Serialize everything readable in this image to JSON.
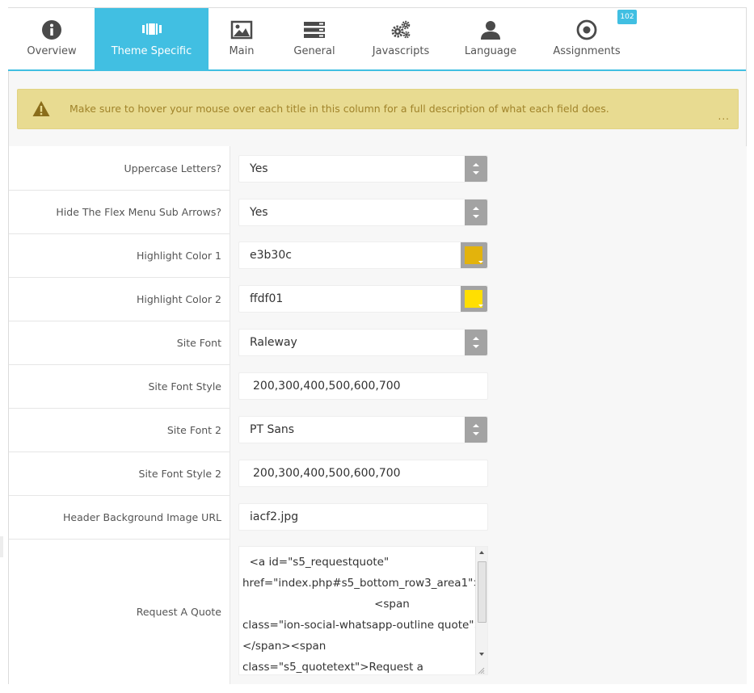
{
  "tabs": [
    {
      "label": "Overview",
      "icon": "info-icon",
      "active": false
    },
    {
      "label": "Theme Specific",
      "icon": "film-icon",
      "active": true
    },
    {
      "label": "Main",
      "icon": "image-icon",
      "active": false
    },
    {
      "label": "General",
      "icon": "server-icon",
      "active": false
    },
    {
      "label": "Javascripts",
      "icon": "gears-icon",
      "active": false
    },
    {
      "label": "Language",
      "icon": "user-icon",
      "active": false
    },
    {
      "label": "Assignments",
      "icon": "target-icon",
      "active": false
    }
  ],
  "badge": "102",
  "alert": {
    "text": "Make sure to hover your mouse over each title in this column for a full description of what each field does.",
    "more": "..."
  },
  "fields": {
    "uppercase": {
      "label": "Uppercase Letters?",
      "value": "Yes"
    },
    "hide_arrows": {
      "label": "Hide The Flex Menu Sub Arrows?",
      "value": "Yes"
    },
    "highlight1": {
      "label": "Highlight Color 1",
      "value": "e3b30c",
      "swatch": "#e3b30c"
    },
    "highlight2": {
      "label": "Highlight Color 2",
      "value": "ffdf01",
      "swatch": "#ffdf01"
    },
    "site_font": {
      "label": "Site Font",
      "value": "Raleway"
    },
    "site_font_style": {
      "label": "Site Font Style",
      "value": "200,300,400,500,600,700"
    },
    "site_font2": {
      "label": "Site Font 2",
      "value": "PT Sans"
    },
    "site_font_style2": {
      "label": "Site Font Style 2",
      "value": "200,300,400,500,600,700"
    },
    "header_bg": {
      "label": "Header Background Image URL",
      "value": "iacf2.jpg"
    },
    "request_quote": {
      "label": "Request A Quote",
      "value": "  <a id=\"s5_requestquote\"\nhref=\"index.php#s5_bottom_row3_area1\">\n                                      <span\nclass=\"ion-social-whatsapp-outline quote\">\n</span><span\nclass=\"s5_quotetext\">Request a"
    }
  },
  "colors": {
    "accent": "#41bfe2",
    "alert_bg": "#e8db91",
    "alert_text": "#a0832a"
  }
}
